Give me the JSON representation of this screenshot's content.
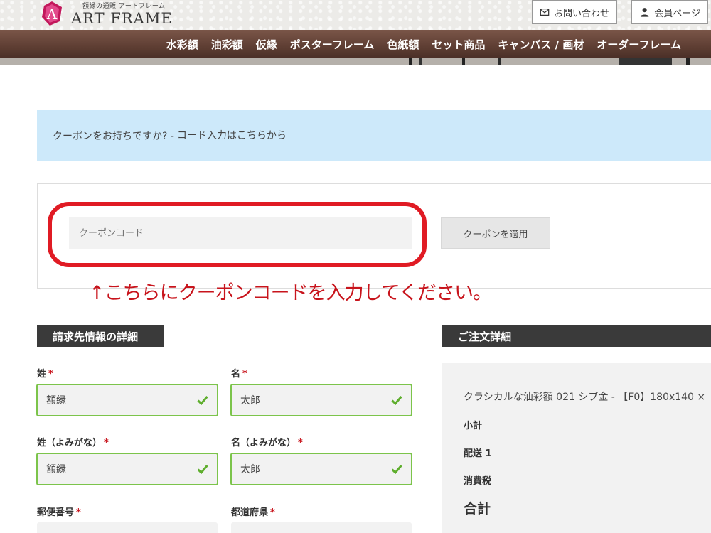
{
  "header": {
    "logo_subtitle": "額縁の通販 アートフレーム",
    "logo_text": "ART FRAME",
    "contact_label": "お問い合わせ",
    "member_label": "会員ページ"
  },
  "nav": {
    "items": [
      "水彩額",
      "油彩額",
      "仮縁",
      "ポスターフレーム",
      "色紙額",
      "セット商品",
      "キャンバス / 画材",
      "オーダーフレーム"
    ]
  },
  "coupon": {
    "notice_text": "クーポンをお持ちですか? -",
    "notice_link": "コード入力はこちらから",
    "input_placeholder": "クーポンコード",
    "apply_label": "クーポンを適用",
    "annotation": "↑こちらにクーポンコードを入力してください。"
  },
  "billing": {
    "title": "請求先情報の詳細",
    "required_mark": "*",
    "last_name_label": "姓",
    "last_name_value": "額縁",
    "first_name_label": "名",
    "first_name_value": "太郎",
    "last_kana_label": "姓（よみがな）",
    "last_kana_value": "額縁",
    "first_kana_label": "名（よみがな）",
    "first_kana_value": "太郎",
    "postcode_label": "郵便番号",
    "prefecture_label": "都道府県"
  },
  "order": {
    "title": "ご注文詳細",
    "product": "クラシカルな油彩額 021 シブ金 - 【F0】180x140 ×",
    "subtotal_label": "小計",
    "shipping_label": "配送 1",
    "tax_label": "消費税",
    "total_label": "合計"
  },
  "colors": {
    "nav_brown": "#5e3e33",
    "notice_blue": "#cde9fa",
    "valid_green": "#7cc44b",
    "annotation_red": "#e01b24",
    "section_dark": "#3a3a3a"
  }
}
